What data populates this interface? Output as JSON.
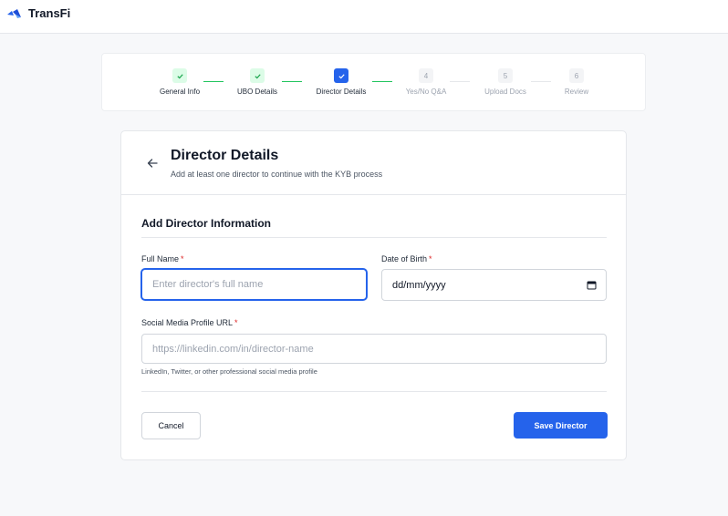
{
  "header": {
    "brand": "TransFi",
    "logo_icon": "transfi-logo-icon"
  },
  "stepper": {
    "steps": [
      {
        "index": "1",
        "label": "General Info",
        "status": "done"
      },
      {
        "index": "2",
        "label": "UBO Details",
        "status": "done"
      },
      {
        "index": "3",
        "label": "Director Details",
        "status": "active"
      },
      {
        "index": "4",
        "label": "Yes/No Q&A",
        "status": "pending"
      },
      {
        "index": "5",
        "label": "Upload Docs",
        "status": "pending"
      },
      {
        "index": "6",
        "label": "Review",
        "status": "pending"
      }
    ]
  },
  "card": {
    "title": "Director Details",
    "subtitle": "Add at least one director to continue with the KYB process",
    "back_icon": "arrow-left-icon"
  },
  "form": {
    "section_title": "Add Director Information",
    "full_name": {
      "label": "Full Name",
      "required_mark": "*",
      "placeholder": "Enter director's full name",
      "value": ""
    },
    "dob": {
      "label": "Date of Birth",
      "required_mark": "*",
      "value": "dd/mm/yyyy",
      "icon": "calendar-icon"
    },
    "social": {
      "label": "Social Media Profile URL",
      "required_mark": "*",
      "placeholder": "https://linkedin.com/in/director-name",
      "value": "",
      "helper": "LinkedIn, Twitter, or other professional social media profile"
    },
    "cancel_label": "Cancel",
    "save_label": "Save Director"
  },
  "colors": {
    "primary": "#2563eb",
    "success": "#22c55e",
    "success_bg": "#dcfce7",
    "required": "#dc2626",
    "page_bg": "#f7f8fa"
  }
}
